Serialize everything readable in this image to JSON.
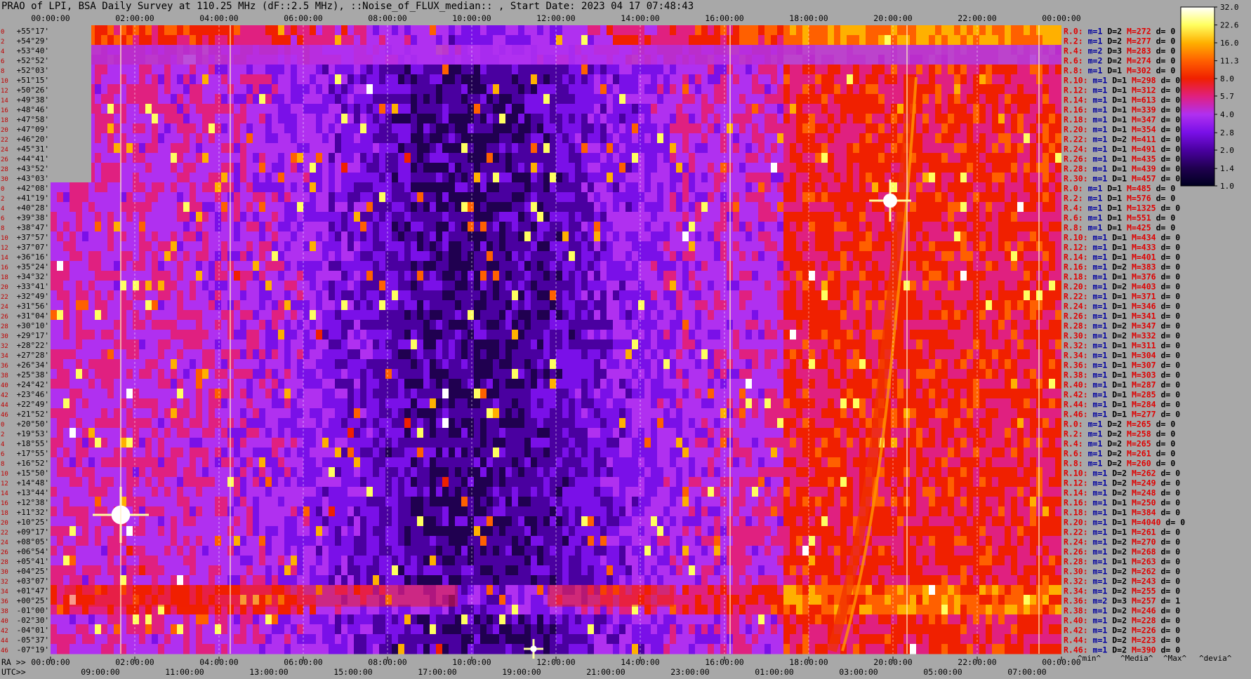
{
  "title": "PRAO of LPI, BSA Daily Survey at 110.25 MHz (dF::2.5 MHz), ::Noise_of_FLUX_median:: , Start Date: 2023 04 17 07:48:43",
  "chart_data": {
    "type": "heatmap",
    "x_top_labels": [
      "00:00:00",
      "02:00:00",
      "04:00:00",
      "06:00:00",
      "08:00:00",
      "10:00:00",
      "12:00:00",
      "14:00:00",
      "16:00:00",
      "18:00:00",
      "20:00:00",
      "22:00:00",
      "00:00:00"
    ],
    "ra_prefix": "RA >>",
    "ra_labels": [
      "00:00:00",
      "02:00:00",
      "04:00:00",
      "06:00:00",
      "08:00:00",
      "10:00:00",
      "12:00:00",
      "14:00:00",
      "16:00:00",
      "18:00:00",
      "20:00:00",
      "22:00:00",
      "00:00:00"
    ],
    "utc_prefix": "UTC>>",
    "utc_labels": [
      "09:00:00",
      "11:00:00",
      "13:00:00",
      "15:00:00",
      "17:00:00",
      "19:00:00",
      "21:00:00",
      "23:00:00",
      "01:00:00",
      "03:00:00",
      "05:00:00",
      "07:00:00"
    ],
    "declinations": [
      "+55°17'",
      "+54°29'",
      "+53°40'",
      "+52°52'",
      "+52°03'",
      "+51°15'",
      "+50°26'",
      "+49°38'",
      "+48°46'",
      "+47°58'",
      "+47°09'",
      "+46°20'",
      "+45°31'",
      "+44°41'",
      "+43°52'",
      "+43°03'",
      "+42°08'",
      "+41°19'",
      "+40°28'",
      "+39°38'",
      "+38°47'",
      "+37°57'",
      "+37°07'",
      "+36°16'",
      "+35°24'",
      "+34°32'",
      "+33°41'",
      "+32°49'",
      "+31°56'",
      "+31°04'",
      "+30°10'",
      "+29°17'",
      "+28°22'",
      "+27°28'",
      "+26°34'",
      "+25°38'",
      "+24°42'",
      "+23°46'",
      "+22°49'",
      "+21°52'",
      "+20°50'",
      "+19°53'",
      "+18°55'",
      "+17°55'",
      "+16°52'",
      "+15°50'",
      "+14°48'",
      "+13°44'",
      "+12°38'",
      "+11°32'",
      "+10°25'",
      "+09°17'",
      "+08°05'",
      "+06°54'",
      "+05°41'",
      "+04°25'",
      "+03°07'",
      "+01°47'",
      "+00°25'",
      "-01°00'",
      "-02°30'",
      "-04°01'",
      "-05°37'",
      "-07°19'"
    ],
    "beam_numbers": [
      "0",
      "2",
      "4",
      "6",
      "8",
      "10",
      "12",
      "14",
      "16",
      "18",
      "20",
      "22",
      "24",
      "26",
      "28",
      "30",
      "0",
      "2",
      "4",
      "6",
      "8",
      "10",
      "12",
      "14",
      "16",
      "18",
      "20",
      "22",
      "24",
      "26",
      "28",
      "30",
      "32",
      "34",
      "36",
      "38",
      "40",
      "42",
      "44",
      "46",
      "0",
      "2",
      "4",
      "6",
      "8",
      "10",
      "12",
      "14",
      "16",
      "18",
      "20",
      "22",
      "24",
      "26",
      "28",
      "30",
      "32",
      "34",
      "36",
      "38",
      "40",
      "42",
      "44",
      "46"
    ],
    "stats": [
      {
        "r": "R.0:",
        "m": "m=1",
        "D": "D=2",
        "M": "M=272",
        "d": "d= 0"
      },
      {
        "r": "R.2:",
        "m": "m=1",
        "D": "D=2",
        "M": "M=277",
        "d": "d= 0"
      },
      {
        "r": "R.4:",
        "m": "m=2",
        "D": "D=3",
        "M": "M=283",
        "d": "d= 0"
      },
      {
        "r": "R.6:",
        "m": "m=2",
        "D": "D=2",
        "M": "M=274",
        "d": "d= 0"
      },
      {
        "r": "R.8:",
        "m": "m=1",
        "D": "D=1",
        "M": "M=302",
        "d": "d= 0"
      },
      {
        "r": "R.10:",
        "m": "m=1",
        "D": "D=1",
        "M": "M=298",
        "d": "d= 0"
      },
      {
        "r": "R.12:",
        "m": "m=1",
        "D": "D=1",
        "M": "M=312",
        "d": "d= 0"
      },
      {
        "r": "R.14:",
        "m": "m=1",
        "D": "D=1",
        "M": "M=613",
        "d": "d= 0"
      },
      {
        "r": "R.16:",
        "m": "m=1",
        "D": "D=1",
        "M": "M=339",
        "d": "d= 0"
      },
      {
        "r": "R.18:",
        "m": "m=1",
        "D": "D=1",
        "M": "M=347",
        "d": "d= 0"
      },
      {
        "r": "R.20:",
        "m": "m=1",
        "D": "D=1",
        "M": "M=354",
        "d": "d= 0"
      },
      {
        "r": "R.22:",
        "m": "m=1",
        "D": "D=2",
        "M": "M=411",
        "d": "d= 0"
      },
      {
        "r": "R.24:",
        "m": "m=1",
        "D": "D=1",
        "M": "M=491",
        "d": "d= 0"
      },
      {
        "r": "R.26:",
        "m": "m=1",
        "D": "D=1",
        "M": "M=435",
        "d": "d= 0"
      },
      {
        "r": "R.28:",
        "m": "m=1",
        "D": "D=1",
        "M": "M=439",
        "d": "d= 0"
      },
      {
        "r": "R.30:",
        "m": "m=1",
        "D": "D=1",
        "M": "M=457",
        "d": "d= 0"
      },
      {
        "r": "R.0:",
        "m": "m=1",
        "D": "D=1",
        "M": "M=485",
        "d": "d= 0"
      },
      {
        "r": "R.2:",
        "m": "m=1",
        "D": "D=1",
        "M": "M=576",
        "d": "d= 0"
      },
      {
        "r": "R.4:",
        "m": "m=1",
        "D": "D=1",
        "M": "M=1325",
        "d": "d= 0"
      },
      {
        "r": "R.6:",
        "m": "m=1",
        "D": "D=1",
        "M": "M=551",
        "d": "d= 0"
      },
      {
        "r": "R.8:",
        "m": "m=1",
        "D": "D=1",
        "M": "M=425",
        "d": "d= 0"
      },
      {
        "r": "R.10:",
        "m": "m=1",
        "D": "D=1",
        "M": "M=434",
        "d": "d= 0"
      },
      {
        "r": "R.12:",
        "m": "m=1",
        "D": "D=1",
        "M": "M=433",
        "d": "d= 0"
      },
      {
        "r": "R.14:",
        "m": "m=1",
        "D": "D=1",
        "M": "M=401",
        "d": "d= 0"
      },
      {
        "r": "R.16:",
        "m": "m=1",
        "D": "D=2",
        "M": "M=383",
        "d": "d= 0"
      },
      {
        "r": "R.18:",
        "m": "m=1",
        "D": "D=1",
        "M": "M=376",
        "d": "d= 0"
      },
      {
        "r": "R.20:",
        "m": "m=1",
        "D": "D=2",
        "M": "M=403",
        "d": "d= 0"
      },
      {
        "r": "R.22:",
        "m": "m=1",
        "D": "D=1",
        "M": "M=371",
        "d": "d= 0"
      },
      {
        "r": "R.24:",
        "m": "m=1",
        "D": "D=1",
        "M": "M=346",
        "d": "d= 0"
      },
      {
        "r": "R.26:",
        "m": "m=1",
        "D": "D=1",
        "M": "M=341",
        "d": "d= 0"
      },
      {
        "r": "R.28:",
        "m": "m=1",
        "D": "D=2",
        "M": "M=347",
        "d": "d= 0"
      },
      {
        "r": "R.30:",
        "m": "m=1",
        "D": "D=2",
        "M": "M=332",
        "d": "d= 0"
      },
      {
        "r": "R.32:",
        "m": "m=1",
        "D": "D=1",
        "M": "M=311",
        "d": "d= 0"
      },
      {
        "r": "R.34:",
        "m": "m=1",
        "D": "D=1",
        "M": "M=304",
        "d": "d= 0"
      },
      {
        "r": "R.36:",
        "m": "m=1",
        "D": "D=1",
        "M": "M=307",
        "d": "d= 0"
      },
      {
        "r": "R.38:",
        "m": "m=1",
        "D": "D=1",
        "M": "M=303",
        "d": "d= 0"
      },
      {
        "r": "R.40:",
        "m": "m=1",
        "D": "D=1",
        "M": "M=287",
        "d": "d= 0"
      },
      {
        "r": "R.42:",
        "m": "m=1",
        "D": "D=1",
        "M": "M=285",
        "d": "d= 0"
      },
      {
        "r": "R.44:",
        "m": "m=1",
        "D": "D=1",
        "M": "M=284",
        "d": "d= 0"
      },
      {
        "r": "R.46:",
        "m": "m=1",
        "D": "D=1",
        "M": "M=277",
        "d": "d= 0"
      },
      {
        "r": "R.0:",
        "m": "m=1",
        "D": "D=2",
        "M": "M=265",
        "d": "d= 0"
      },
      {
        "r": "R.2:",
        "m": "m=1",
        "D": "D=2",
        "M": "M=258",
        "d": "d= 0"
      },
      {
        "r": "R.4:",
        "m": "m=1",
        "D": "D=2",
        "M": "M=265",
        "d": "d= 0"
      },
      {
        "r": "R.6:",
        "m": "m=1",
        "D": "D=2",
        "M": "M=261",
        "d": "d= 0"
      },
      {
        "r": "R.8:",
        "m": "m=1",
        "D": "D=2",
        "M": "M=260",
        "d": "d= 0"
      },
      {
        "r": "R.10:",
        "m": "m=1",
        "D": "D=2",
        "M": "M=262",
        "d": "d= 0"
      },
      {
        "r": "R.12:",
        "m": "m=1",
        "D": "D=2",
        "M": "M=249",
        "d": "d= 0"
      },
      {
        "r": "R.14:",
        "m": "m=1",
        "D": "D=2",
        "M": "M=248",
        "d": "d= 0"
      },
      {
        "r": "R.16:",
        "m": "m=1",
        "D": "D=1",
        "M": "M=250",
        "d": "d= 0"
      },
      {
        "r": "R.18:",
        "m": "m=1",
        "D": "D=1",
        "M": "M=384",
        "d": "d= 0"
      },
      {
        "r": "R.20:",
        "m": "m=1",
        "D": "D=1",
        "M": "M=4040",
        "d": "d= 0"
      },
      {
        "r": "R.22:",
        "m": "m=1",
        "D": "D=1",
        "M": "M=261",
        "d": "d= 0"
      },
      {
        "r": "R.24:",
        "m": "m=1",
        "D": "D=2",
        "M": "M=270",
        "d": "d= 0"
      },
      {
        "r": "R.26:",
        "m": "m=1",
        "D": "D=2",
        "M": "M=268",
        "d": "d= 0"
      },
      {
        "r": "R.28:",
        "m": "m=1",
        "D": "D=1",
        "M": "M=263",
        "d": "d= 0"
      },
      {
        "r": "R.30:",
        "m": "m=1",
        "D": "D=2",
        "M": "M=262",
        "d": "d= 0"
      },
      {
        "r": "R.32:",
        "m": "m=1",
        "D": "D=2",
        "M": "M=243",
        "d": "d= 0"
      },
      {
        "r": "R.34:",
        "m": "m=1",
        "D": "D=2",
        "M": "M=255",
        "d": "d= 0"
      },
      {
        "r": "R.36:",
        "m": "m=2",
        "D": "D=3",
        "M": "M=257",
        "d": "d= 1"
      },
      {
        "r": "R.38:",
        "m": "m=1",
        "D": "D=2",
        "M": "M=246",
        "d": "d= 0"
      },
      {
        "r": "R.40:",
        "m": "m=1",
        "D": "D=2",
        "M": "M=228",
        "d": "d= 0"
      },
      {
        "r": "R.42:",
        "m": "m=1",
        "D": "D=2",
        "M": "M=226",
        "d": "d= 0"
      },
      {
        "r": "R.44:",
        "m": "m=1",
        "D": "D=2",
        "M": "M=223",
        "d": "d= 0"
      },
      {
        "r": "R.46:",
        "m": "m=1",
        "D": "D=2",
        "M": "M=390",
        "d": "d= 0"
      }
    ],
    "legend_bottom": [
      "^min^",
      "^Media^",
      "^Max^",
      "^devia^"
    ],
    "colorbar": {
      "scale": "log",
      "ticks": [
        "32.0",
        "22.6",
        "16.0",
        "11.3",
        "8.0",
        "5.7",
        "4.0",
        "2.8",
        "2.0",
        "1.4",
        "1.0"
      ],
      "range": [
        1.0,
        32.0
      ]
    },
    "colors": {
      "background": "#a8a8a8",
      "stat_red": "#e00000",
      "stat_blue": "#0000a0",
      "label_red": "#c00000",
      "colormap": [
        "#000020",
        "#200050",
        "#4a00a0",
        "#7a10e8",
        "#b030f0",
        "#e02080",
        "#f02000",
        "#ff6000",
        "#ffb000",
        "#ffff60",
        "#ffffff"
      ]
    }
  }
}
